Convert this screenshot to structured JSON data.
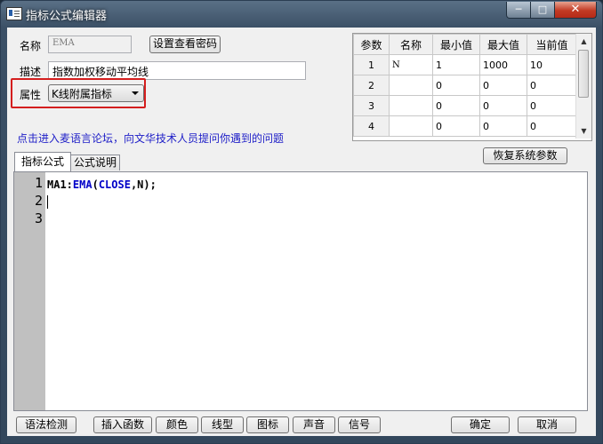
{
  "window": {
    "title": "指标公式编辑器"
  },
  "form": {
    "name_label": "名称",
    "name_value": "EMA",
    "set_password_button": "设置查看密码",
    "desc_label": "描述",
    "desc_value": "指数加权移动平均线",
    "attr_label": "属性",
    "attr_value": "K线附属指标",
    "forum_link": "点击进入麦语言论坛，向文华技术人员提问你遇到的问题"
  },
  "params": {
    "headers": [
      "参数",
      "名称",
      "最小值",
      "最大值",
      "当前值"
    ],
    "rows": [
      {
        "idx": "1",
        "name": "N",
        "min": "1",
        "max": "1000",
        "cur": "10"
      },
      {
        "idx": "2",
        "name": "",
        "min": "0",
        "max": "0",
        "cur": "0"
      },
      {
        "idx": "3",
        "name": "",
        "min": "0",
        "max": "0",
        "cur": "0"
      },
      {
        "idx": "4",
        "name": "",
        "min": "0",
        "max": "0",
        "cur": "0"
      }
    ],
    "restore_button": "恢复系统参数"
  },
  "tabs": [
    {
      "label": "指标公式",
      "active": true
    },
    {
      "label": "公式说明",
      "active": false
    }
  ],
  "editor": {
    "line_numbers": [
      "1",
      "2",
      "3"
    ],
    "code": {
      "name": "MA1:",
      "func": "EMA",
      "open": "(",
      "arg1": "CLOSE",
      "rest": ",N);"
    }
  },
  "toolbar": {
    "syntax_check": "语法检测",
    "insert_func": "插入函数",
    "color": "颜色",
    "line_type": "线型",
    "icon": "图标",
    "sound": "声音",
    "signal": "信号",
    "ok": "确定",
    "cancel": "取消"
  },
  "colors": {
    "link": "#2020c8",
    "highlight_box": "#d41e1e",
    "keyword": "#0000c8"
  }
}
